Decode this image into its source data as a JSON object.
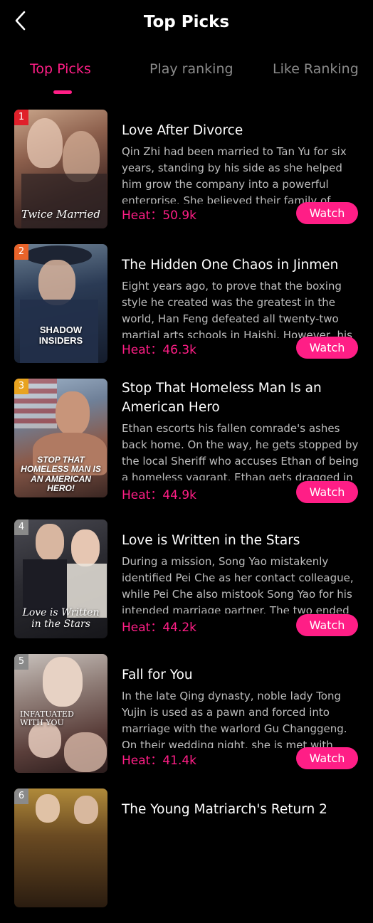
{
  "header": {
    "title": "Top Picks",
    "back_icon": "chevron-left-icon"
  },
  "tabs": [
    {
      "label": "Top Picks",
      "active": true
    },
    {
      "label": "Play ranking",
      "active": false
    },
    {
      "label": "Like Ranking",
      "active": false
    }
  ],
  "colors": {
    "accent": "#ff1e86",
    "background": "#000000",
    "rank1": "#e0202a",
    "rank2": "#e8632a",
    "rank3": "#e8a320",
    "rank_other": "#8a8a8a"
  },
  "items": [
    {
      "rank": "1",
      "poster_text": "Twice Married",
      "title": "Love After Divorce",
      "description": "Qin Zhi had been married to Tan Yu for six years, standing by his side as she helped him grow the company into a powerful enterprise. She believed their family of three would",
      "heat": "Heat：50.9k",
      "watch_label": "Watch"
    },
    {
      "rank": "2",
      "poster_text": "SHADOW INSIDERS",
      "title": "The Hidden One Chaos in Jinmen",
      "description": "Eight years ago, to prove that the boxing style he created was the greatest in the world, Han Feng defeated all twenty-two martial arts schools in Haishi. However, his victory came at",
      "heat": "Heat：46.3k",
      "watch_label": "Watch"
    },
    {
      "rank": "3",
      "poster_text": "STOP THAT HOMELESS MAN IS AN AMERICAN HERO!",
      "title": "Stop That Homeless Man Is an American Hero",
      "description": "Ethan escorts his fallen comrade's ashes back home. On the way, he gets stopped by the local Sheriff who accuses Ethan of being a homeless vagrant. Ethan gets dragged in for questioning",
      "heat": "Heat：44.9k",
      "watch_label": "Watch"
    },
    {
      "rank": "4",
      "poster_text": "Love is Written in the Stars",
      "title": "Love is Written in the Stars",
      "description": "During a mission, Song Yao mistakenly identified Pei Che as her contact colleague, while Pei Che also mistook Song Yao for his intended marriage partner. The two ended up",
      "heat": "Heat：44.2k",
      "watch_label": "Watch"
    },
    {
      "rank": "5",
      "poster_text": "INFATUATED WITH YOU",
      "title": "Fall for You",
      "description": "In the late Qing dynasty, noble lady Tong Yujin is used as a pawn and forced into marriage with the warlord Gu Changgeng. On their wedding night, she is met with threats and cold",
      "heat": "Heat：41.4k",
      "watch_label": "Watch"
    },
    {
      "rank": "6",
      "poster_text": "",
      "title": "The Young Matriarch's Return 2",
      "description": "",
      "heat": "",
      "watch_label": ""
    }
  ]
}
